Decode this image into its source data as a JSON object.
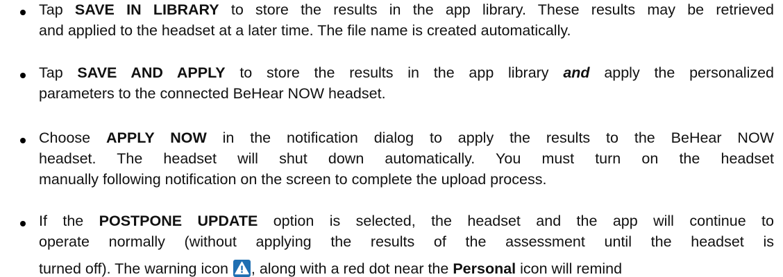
{
  "bullets": [
    {
      "lines": [
        {
          "parts": [
            {
              "t": "Tap "
            },
            {
              "t": "SAVE IN LIBRARY",
              "s": "bold"
            },
            {
              "t": " to store the results in the app library. These results may be retrieved"
            }
          ]
        },
        {
          "parts": [
            {
              "t": "and applied to the headset at a later time. The file name is created automatically."
            }
          ]
        }
      ]
    },
    {
      "lines": [
        {
          "parts": [
            {
              "t": "Tap "
            },
            {
              "t": "SAVE AND APPLY",
              "s": "bold"
            },
            {
              "t": " to store the results in the app library "
            },
            {
              "t": "and",
              "s": "bold-italic"
            },
            {
              "t": " apply the personalized"
            }
          ]
        },
        {
          "parts": [
            {
              "t": "parameters to the connected BeHear NOW headset."
            }
          ]
        }
      ]
    },
    {
      "lines": [
        {
          "parts": [
            {
              "t": "Choose "
            },
            {
              "t": "APPLY NOW",
              "s": "bold"
            },
            {
              "t": " in the notification dialog to apply the results to the BeHear NOW"
            }
          ]
        },
        {
          "parts": [
            {
              "t": "headset. The headset will shut down automatically. You must turn on the headset"
            }
          ]
        },
        {
          "parts": [
            {
              "t": "manually following notification on the screen to complete the upload process."
            }
          ]
        }
      ]
    },
    {
      "lines": [
        {
          "parts": [
            {
              "t": "If the "
            },
            {
              "t": "POSTPONE UPDATE",
              "s": "bold"
            },
            {
              "t": " option is selected, the headset and the app will continue to"
            }
          ]
        },
        {
          "parts": [
            {
              "t": "operate normally (without applying the results of the assessment until the headset is"
            }
          ]
        },
        {
          "parts": [
            {
              "t": "turned off). The warning icon "
            },
            {
              "icon": "warning-icon"
            },
            {
              "t": ", along with a red dot near the "
            },
            {
              "t": "Personal",
              "s": "bold"
            },
            {
              "t": " icon will remind"
            }
          ]
        }
      ]
    }
  ],
  "colors": {
    "text": "#111111",
    "icon_background": "#1f6fb2",
    "icon_triangle": "#ffffff"
  }
}
